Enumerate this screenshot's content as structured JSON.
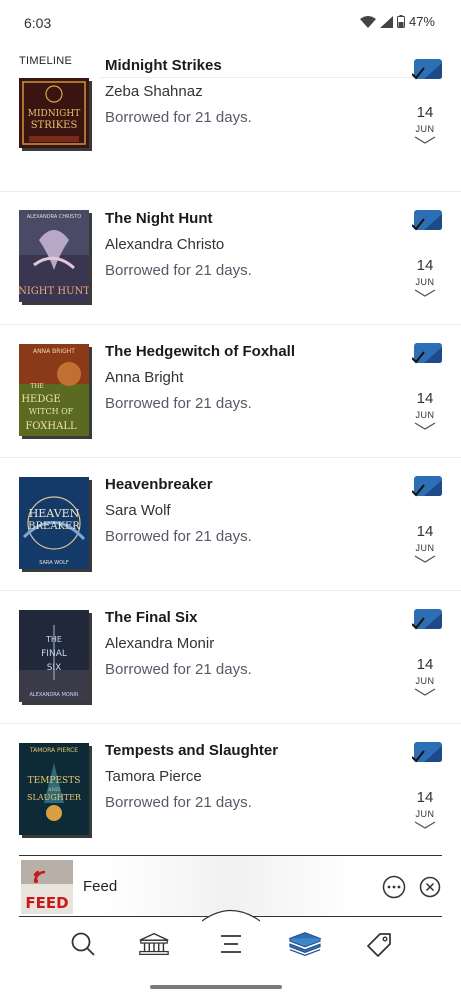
{
  "status_bar": {
    "time": "6:03",
    "battery": "47%"
  },
  "section": {
    "label": "TIMELINE"
  },
  "loans": [
    {
      "title": "Midnight Strikes",
      "author": "Zeba Shahnaz",
      "status": "Borrowed for 21 days.",
      "day": "14",
      "month": "JUN",
      "cover_text": [
        "MIDNIGHT",
        "STRIKES"
      ]
    },
    {
      "title": "The Night Hunt",
      "author": "Alexandra Christo",
      "status": "Borrowed for 21 days.",
      "day": "14",
      "month": "JUN",
      "cover_text": [
        "ALEXANDRA CHRISTO",
        "NIGHT HUNT"
      ]
    },
    {
      "title": "The Hedgewitch of Foxhall",
      "author": "Anna Bright",
      "status": "Borrowed for 21 days.",
      "day": "14",
      "month": "JUN",
      "cover_text": [
        "ANNA BRIGHT",
        "THE",
        "HEDGE",
        "WITCH OF",
        "FOXHALL"
      ]
    },
    {
      "title": "Heavenbreaker",
      "author": "Sara Wolf",
      "status": "Borrowed for 21 days.",
      "day": "14",
      "month": "JUN",
      "cover_text": [
        "HEAVEN",
        "BREAKER",
        "SARA WOLF"
      ]
    },
    {
      "title": "The Final Six",
      "author": "Alexandra Monir",
      "status": "Borrowed for 21 days.",
      "day": "14",
      "month": "JUN",
      "cover_text": [
        "THE",
        "FINAL",
        "SIX",
        "ALEXANDRA MONIR"
      ]
    },
    {
      "title": "Tempests and Slaughter",
      "author": "Tamora Pierce",
      "status": "Borrowed for 21 days.",
      "day": "14",
      "month": "JUN",
      "cover_text": [
        "TAMORA PIERCE",
        "TEMPESTS",
        "AND",
        "SLAUGHTER"
      ]
    }
  ],
  "mini_player": {
    "title": "Feed",
    "cover_text": "FEED"
  },
  "nav": [
    {
      "icon": "search-icon"
    },
    {
      "icon": "library-icon"
    },
    {
      "icon": "menu-icon"
    },
    {
      "icon": "shelf-icon",
      "active": true
    },
    {
      "icon": "tag-icon"
    }
  ],
  "colors": {
    "accent": "#2d6fb4",
    "accent_dark": "#1f4a8a",
    "divider": "#ececec"
  }
}
